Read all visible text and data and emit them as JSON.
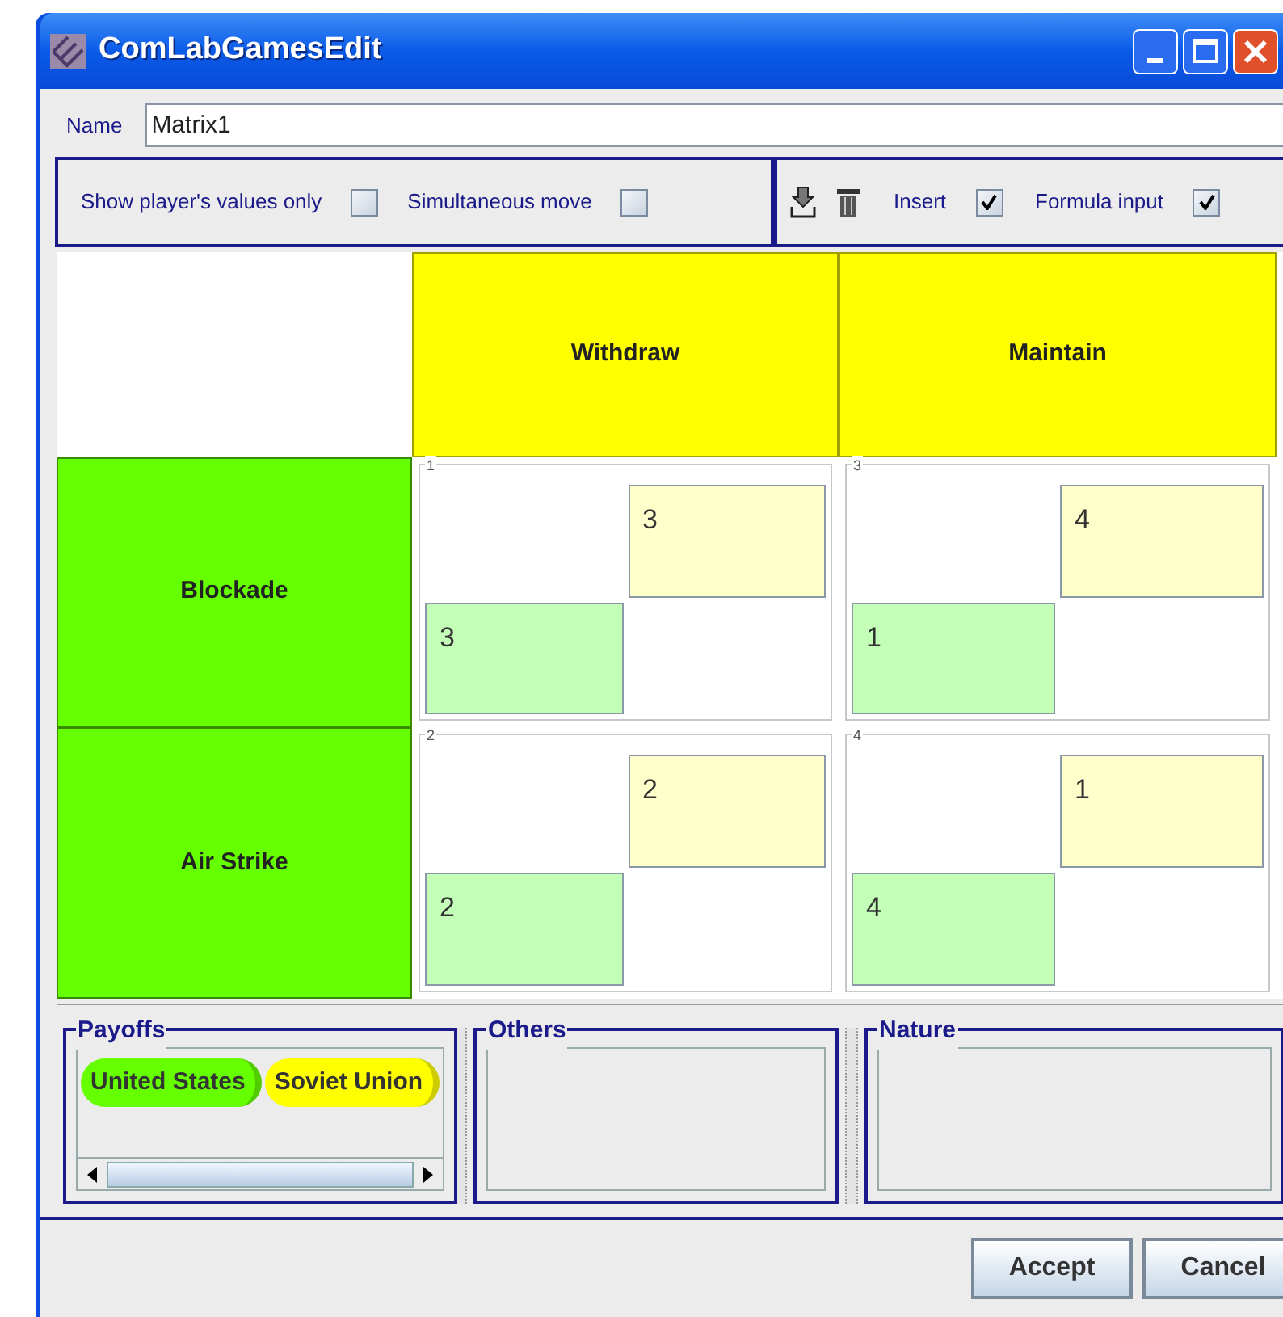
{
  "window": {
    "title": "ComLabGamesEdit"
  },
  "name_field": {
    "label": "Name",
    "value": "Matrix1"
  },
  "options": [
    {
      "label": "Show player's values only",
      "checked": false
    },
    {
      "label": "Simultaneous move",
      "checked": false
    }
  ],
  "edit_options": [
    {
      "label": "Insert",
      "checked": true
    },
    {
      "label": "Formula input",
      "checked": true
    }
  ],
  "matrix": {
    "columns": [
      "Withdraw",
      "Maintain"
    ],
    "rows": [
      {
        "label": "Blockade",
        "cells": [
          {
            "number": "1",
            "column_payoff": "3",
            "row_payoff": "3"
          },
          {
            "number": "3",
            "column_payoff": "4",
            "row_payoff": "1"
          }
        ]
      },
      {
        "label": "Air Strike",
        "cells": [
          {
            "number": "2",
            "column_payoff": "2",
            "row_payoff": "2"
          },
          {
            "number": "4",
            "column_payoff": "1",
            "row_payoff": "4"
          }
        ]
      }
    ]
  },
  "panels": [
    {
      "title": "Payoffs",
      "players": [
        {
          "name": "United States",
          "color": "#66ff00"
        },
        {
          "name": "Soviet Union",
          "color": "#ffff00"
        }
      ]
    },
    {
      "title": "Others"
    },
    {
      "title": "Nature"
    }
  ],
  "buttons": [
    "Accept",
    "Cancel"
  ]
}
